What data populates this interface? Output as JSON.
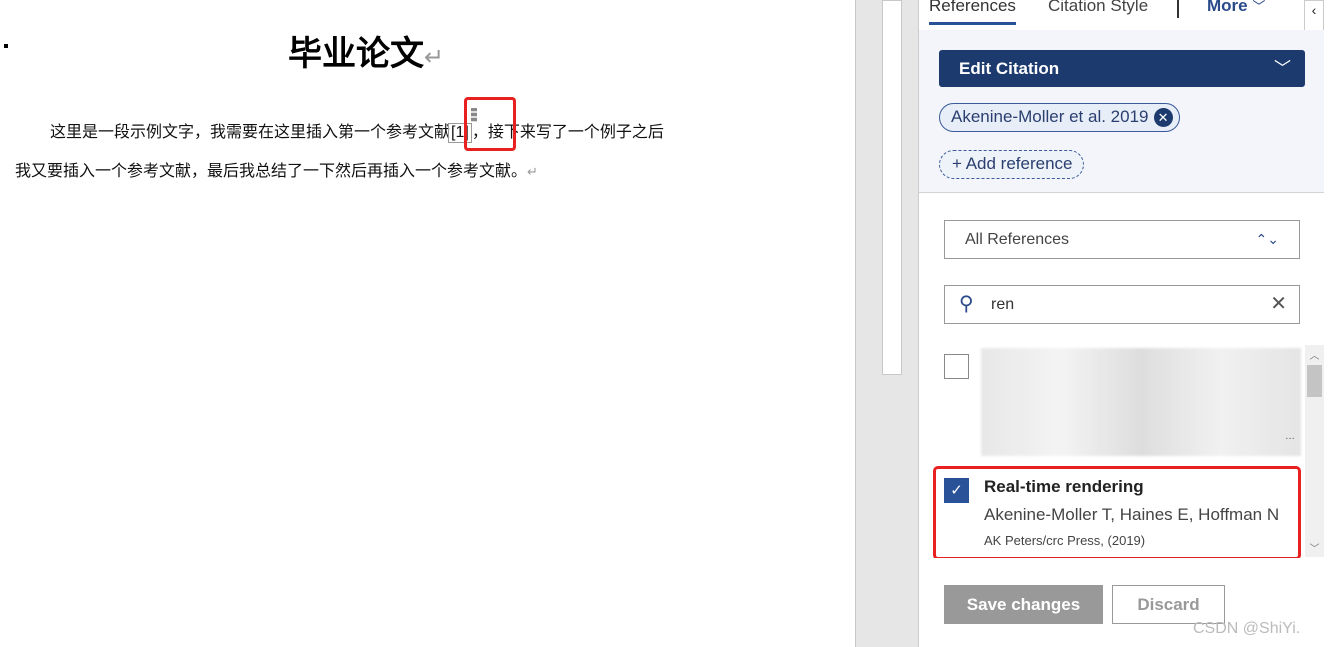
{
  "document": {
    "title": "毕业论文",
    "paragraph_mark": "↵",
    "para1_before": "这里是一段示例文字，我需要在这里插入第一个参考文献",
    "citation": "[1]",
    "para1_after": "，接下来写了一个例子之后",
    "para2": "我又要插入一个参考文献，最后我总结了一下然后再插入一个参考文献。"
  },
  "panel": {
    "tabs": [
      {
        "label": "References",
        "active": true
      },
      {
        "label": "Citation Style",
        "active": false
      },
      {
        "label": "More",
        "active": false
      }
    ],
    "more_chevron": "﹀",
    "collapse_icon": "‹",
    "edit_citation": {
      "label": "Edit Citation",
      "chevron": "﹀"
    },
    "cited_chip": {
      "label": "Akenine-Moller et al. 2019",
      "remove_icon": "✕"
    },
    "add_reference": "+ Add reference",
    "filter": {
      "value": "All References",
      "arrow": "⌃⌄"
    },
    "search": {
      "value": "ren",
      "icon": "⚲",
      "clear": "✕"
    },
    "results": [
      {
        "checked": false,
        "title": "",
        "authors": "",
        "publisher": "",
        "redacted": true,
        "ellipsis": "…"
      },
      {
        "checked": true,
        "title": "Real-time rendering",
        "authors": "Akenine-Moller T, Haines E, Hoffman N",
        "publisher": "AK Peters/crc Press, (2019)"
      }
    ],
    "save_label": "Save changes",
    "discard_label": "Discard"
  },
  "watermark": "CSDN @ShiYi.",
  "colors": {
    "accent": "#1c3a6e",
    "highlight": "#e82020",
    "checkbox": "#2a5298"
  }
}
